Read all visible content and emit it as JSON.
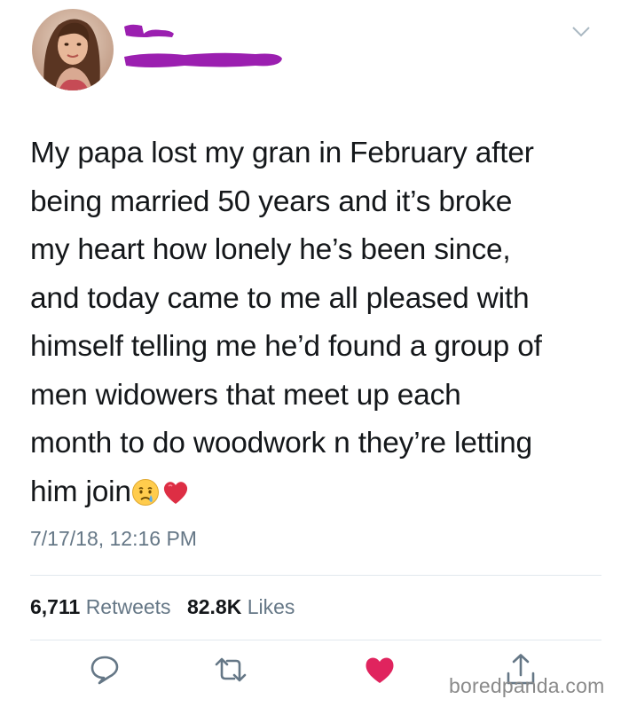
{
  "tweet": {
    "lines": [
      "My papa lost my gran in February after",
      "being married 50 years and it’s broke",
      "my heart how lonely he’s been since,",
      "and today came to me all pleased with",
      "himself telling me he’d found a group of",
      "men widowers that meet up each",
      "month to do woodwork n they’re letting"
    ],
    "last_line": "him join",
    "emojis": [
      "crying-face",
      "red-heart"
    ],
    "timestamp": "7/17/18, 12:16 PM"
  },
  "stats": {
    "retweets_count": "6,711",
    "retweets_label": "Retweets",
    "likes_count": "82.8K",
    "likes_label": "Likes"
  },
  "actions": {
    "icons": [
      "reply-icon",
      "retweet-icon",
      "like-icon",
      "share-icon"
    ],
    "like_color": "#e0245e",
    "icon_color": "#657786"
  },
  "colors": {
    "redaction": "#9b1fb0",
    "secondary_text": "#657786",
    "primary_text": "#14171a"
  },
  "watermark": "boredpanda.com"
}
